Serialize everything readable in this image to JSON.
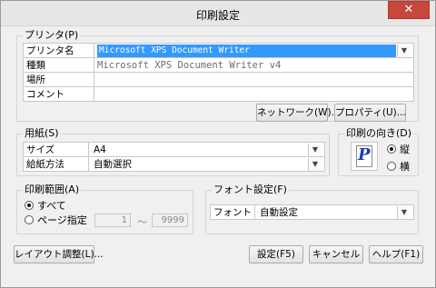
{
  "window": {
    "title": "印刷設定",
    "close_label": "✕"
  },
  "printer": {
    "group_label": "プリンタ(P)",
    "rows": [
      {
        "label": "プリンタ名",
        "value": "Microsoft XPS Document Writer"
      },
      {
        "label": "種類",
        "value": "Microsoft XPS Document Writer v4"
      },
      {
        "label": "場所",
        "value": ""
      },
      {
        "label": "コメント",
        "value": ""
      }
    ],
    "network_button": "ネットワーク(W)...",
    "properties_button": "プロパティ(U)..."
  },
  "paper": {
    "group_label": "用紙(S)",
    "rows": [
      {
        "label": "サイズ",
        "value": "A4"
      },
      {
        "label": "給紙方法",
        "value": "自動選択"
      }
    ]
  },
  "orientation": {
    "group_label": "印刷の向き(D)",
    "options": [
      {
        "label": "縦",
        "selected": true
      },
      {
        "label": "横",
        "selected": false
      }
    ]
  },
  "print_range": {
    "group_label": "印刷範囲(A)",
    "all_label": "すべて",
    "pages_label": "ページ指定",
    "all_selected": true,
    "from": "1",
    "separator": "～",
    "to": "9999"
  },
  "font": {
    "group_label": "フォント設定(F)",
    "label": "フォント",
    "value": "自動設定"
  },
  "buttons": {
    "layout": "レイアウト調整(L)...",
    "ok": "設定(F5)",
    "cancel": "キャンセル",
    "help": "ヘルプ(F1)"
  },
  "icons": {
    "dropdown": "▼",
    "portrait_preview": "P"
  }
}
